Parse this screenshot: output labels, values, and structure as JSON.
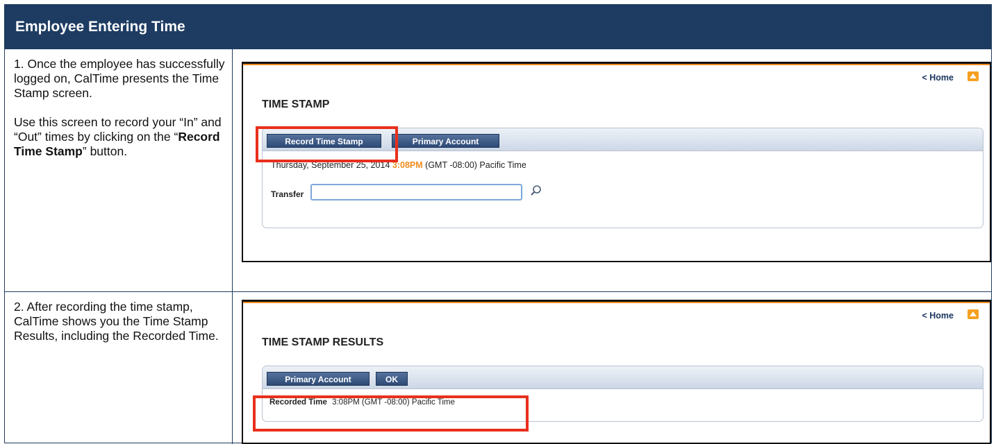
{
  "header": {
    "title": "Employee Entering Time"
  },
  "step1": {
    "para1": "1. Once the employee has successfully logged on, CalTime presents the Time Stamp screen.",
    "para2_pre": "Use this screen to record your “In” and “Out” times by clicking on the “",
    "para2_bold": "Record Time Stamp",
    "para2_post": "” button."
  },
  "step2": {
    "para1": "2.  After recording the time stamp, CalTime shows you the Time Stamp Results, including the Recorded Time."
  },
  "shot1": {
    "home_link": "< Home",
    "title": "TIME STAMP",
    "record_button": "Record Time Stamp",
    "primary_button": "Primary Account",
    "date": "Thursday, September 25, 2014",
    "time": "3:08PM",
    "timezone": "(GMT -08:00) Pacific Time",
    "transfer_label": "Transfer",
    "transfer_value": ""
  },
  "shot2": {
    "home_link": "< Home",
    "title": "TIME STAMP RESULTS",
    "primary_button": "Primary Account",
    "ok_button": "OK",
    "recorded_label": "Recorded Time",
    "recorded_value": "3:08PM (GMT -08:00) Pacific Time"
  },
  "colors": {
    "header_bg": "#1e3c62",
    "highlight": "#e8301c",
    "accent_orange": "#f08c1e",
    "button_bg": "#3d5a86"
  },
  "icons": {
    "top": "arrow-up-icon",
    "search": "magnifier-icon"
  }
}
